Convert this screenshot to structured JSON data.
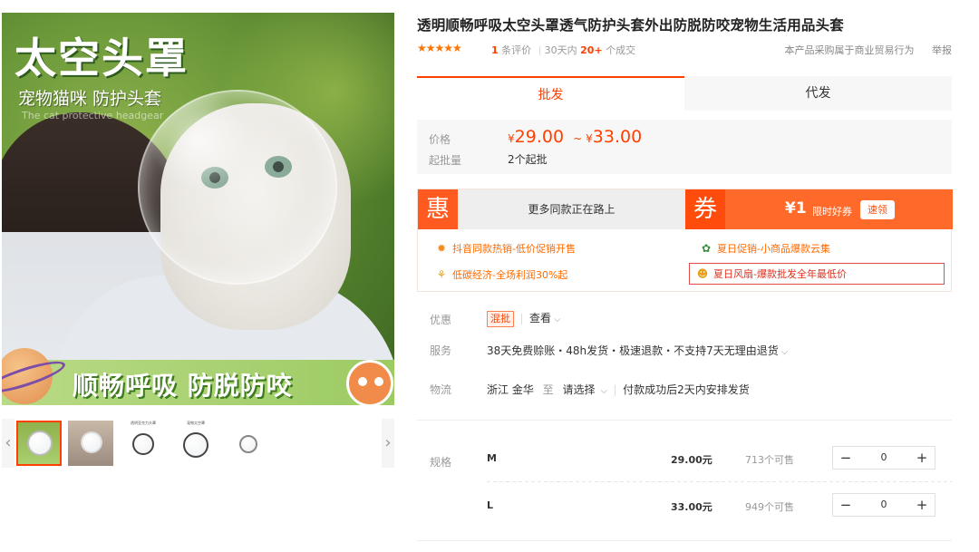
{
  "gallery": {
    "headline": "太空头罩",
    "subtitle": "宠物猫咪 防护头套",
    "english": "The cat protective headgear",
    "banner": "顺畅呼吸 防脱防咬",
    "prev_arrow": "‹",
    "next_arrow": "›",
    "thumb_captions": [
      "透明亚克力头罩",
      "宠物太空罩"
    ]
  },
  "product": {
    "title": "透明顺畅呼吸太空头罩透气防护头套外出防脱防咬宠物生活用品头套",
    "stars": "★★★★★",
    "review_count": "1",
    "review_label": "条评价",
    "days_label": "30天内",
    "sold_count": "20+",
    "sold_label": "个成交",
    "notice": "本产品采购属于商业贸易行为",
    "report": "举报"
  },
  "tabs": {
    "wholesale": "批发",
    "dropship": "代发"
  },
  "pricing": {
    "price_label": "价格",
    "currency": "¥",
    "min_price": "29.00",
    "tilde": "~",
    "max_price": "33.00",
    "moq_label": "起批量",
    "moq_value": "2个起批"
  },
  "promo": {
    "hui": "惠",
    "hui_text": "更多同款正在路上",
    "quan": "券",
    "coupon_amount": "¥1",
    "coupon_label": "限时好券",
    "coupon_button": "速领",
    "activities": [
      {
        "icon": "✹",
        "text": "抖音同款热销-低价促销开售"
      },
      {
        "icon": "✿",
        "text": "夏日促销-小商品爆款云集"
      },
      {
        "icon": "⚘",
        "text": "低碳经济-全场利润30%起"
      },
      {
        "icon": "☻",
        "text": "夏日风扇-爆款批发全年最低价"
      }
    ]
  },
  "info": {
    "discount_label": "优惠",
    "discount_tag": "混批",
    "view": "查看",
    "service_label": "服务",
    "service_text": "38天免费赊账・48h发货・极速退款・不支持7天无理由退货",
    "logistics_label": "物流",
    "origin": "浙江 金华",
    "to": "至",
    "choose": "请选择",
    "ship_note": "付款成功后2天内安排发货"
  },
  "specs": {
    "label": "规格",
    "rows": [
      {
        "name": "M",
        "price": "29.00元",
        "stock": "713个可售",
        "qty": "0"
      },
      {
        "name": "L",
        "price": "33.00元",
        "stock": "949个可售",
        "qty": "0"
      }
    ],
    "minus": "−",
    "plus": "+"
  },
  "colors": {
    "accent": "#ff4000",
    "promo_orange": "#ff6a2b",
    "star": "#ff7300"
  }
}
